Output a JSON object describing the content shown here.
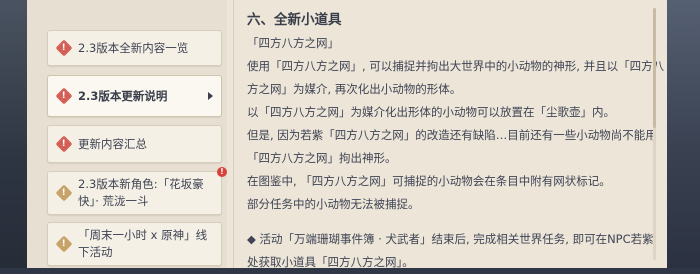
{
  "sidebar": {
    "items": [
      {
        "label_lines": [
          "2.3版本全新内容一览"
        ],
        "icon": "red-exclamation-diamond-icon",
        "active": false
      },
      {
        "label_lines": [
          "2.3版本更新说明"
        ],
        "icon": "red-exclamation-diamond-icon",
        "active": true
      },
      {
        "label_lines": [
          "更新内容汇总"
        ],
        "icon": "red-exclamation-diamond-icon",
        "active": false
      },
      {
        "label_lines": [
          "2.3版本新角色:「花坂豪",
          "快」· 荒泷一斗"
        ],
        "icon": "gold-exclamation-diamond-icon",
        "active": false,
        "badge": "!"
      },
      {
        "label_lines": [
          "「周末一小时 x 原神」线",
          "下活动"
        ],
        "icon": "gold-exclamation-diamond-icon",
        "active": false
      }
    ]
  },
  "content": {
    "heading": "六、全新小道具",
    "lines": [
      "「四方八方之网」",
      "使用「四方八方之网」, 可以捕捉并拘出大世界中的小动物的神形, 并且以「四方八",
      "方之网」为媒介, 再次化出小动物的形体。",
      "以「四方八方之网」为媒介化出形体的小动物可以放置在「尘歌壶」内。",
      "但是, 因为若紫「四方八方之网」的改造还有缺陷…目前还有一些小动物尚不能用",
      "「四方八方之网」拘出神形。",
      "在图鉴中, 「四方八方之网」可捕捉的小动物会在条目中附有网状标记。",
      "部分任务中的小动物无法被捕捉。",
      "◆ 活动「万端珊瑚事件簿 · 犬武者」结束后, 完成相关世界任务, 即可在NPC若紫",
      "处获取小道具「四方八方之网」。"
    ]
  },
  "colors": {
    "panel_bg": "#ece5d8",
    "text": "#3f4454",
    "red_icon": "#d45f57",
    "gold_icon": "#c7a36a",
    "badge": "#d9413b"
  }
}
